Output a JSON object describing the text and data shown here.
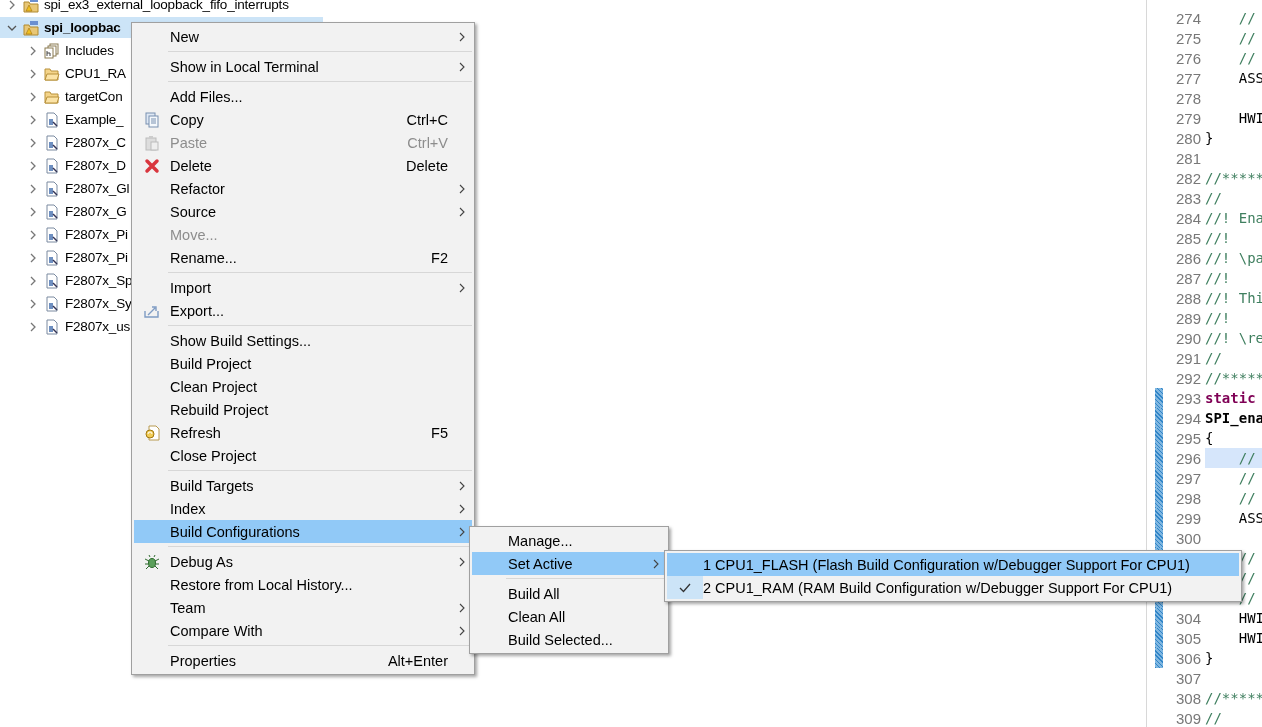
{
  "tree": [
    {
      "label": "spi_ex3_external_loopback_fifo_interrupts",
      "kind": "project",
      "expanded": false,
      "selected": false
    },
    {
      "label": "spi_loopbac",
      "kind": "project",
      "expanded": true,
      "selected": true,
      "children": [
        {
          "label": "Includes",
          "kind": "includes",
          "expanded": false,
          "selected": false
        },
        {
          "label": "CPU1_RA",
          "kind": "folder",
          "expanded": false,
          "selected": false
        },
        {
          "label": "targetCon",
          "kind": "folder",
          "expanded": false,
          "selected": false
        },
        {
          "label": "Example_",
          "kind": "file",
          "expanded": false,
          "selected": false
        },
        {
          "label": "F2807x_C",
          "kind": "file",
          "expanded": false,
          "selected": false
        },
        {
          "label": "F2807x_D",
          "kind": "file",
          "expanded": false,
          "selected": false
        },
        {
          "label": "F2807x_Gl",
          "kind": "file",
          "expanded": false,
          "selected": false
        },
        {
          "label": "F2807x_G",
          "kind": "file",
          "expanded": false,
          "selected": false
        },
        {
          "label": "F2807x_Pi",
          "kind": "file",
          "expanded": false,
          "selected": false
        },
        {
          "label": "F2807x_Pi",
          "kind": "file",
          "expanded": false,
          "selected": false
        },
        {
          "label": "F2807x_Sp",
          "kind": "file",
          "expanded": false,
          "selected": false
        },
        {
          "label": "F2807x_Sy",
          "kind": "file",
          "expanded": false,
          "selected": false
        },
        {
          "label": "F2807x_us",
          "kind": "file",
          "expanded": false,
          "selected": false
        }
      ]
    }
  ],
  "editor": {
    "lines": [
      {
        "number": "274",
        "code": "    //",
        "kind": "comment",
        "changed": false,
        "current": false
      },
      {
        "number": "275",
        "code": "    //",
        "kind": "comment",
        "changed": false,
        "current": false
      },
      {
        "number": "276",
        "code": "    //",
        "kind": "comment",
        "changed": false,
        "current": false
      },
      {
        "number": "277",
        "code": "    ASS",
        "kind": "plain",
        "changed": false,
        "current": false
      },
      {
        "number": "278",
        "changed": false
      },
      {
        "number": "279",
        "code": "    HWI",
        "kind": "plain",
        "changed": false,
        "current": false
      },
      {
        "number": "280",
        "code": "}",
        "kind": "plain",
        "changed": false,
        "current": false
      },
      {
        "number": "281",
        "changed": false
      },
      {
        "number": "282",
        "code": "//*****",
        "kind": "comment",
        "changed": false,
        "current": false
      },
      {
        "number": "283",
        "code": "//",
        "kind": "comment",
        "changed": false,
        "current": false
      },
      {
        "number": "284",
        "code": "//! Ena",
        "kind": "comment",
        "changed": false,
        "current": false
      },
      {
        "number": "285",
        "code": "//!",
        "kind": "comment",
        "changed": false,
        "current": false
      },
      {
        "number": "286",
        "code": "//! \\pa",
        "kind": "comment",
        "changed": false,
        "current": false
      },
      {
        "number": "287",
        "code": "//!",
        "kind": "comment",
        "changed": false,
        "current": false
      },
      {
        "number": "288",
        "code": "//! Thi",
        "kind": "comment",
        "changed": false,
        "current": false
      },
      {
        "number": "289",
        "code": "//!",
        "kind": "comment",
        "changed": false,
        "current": false
      },
      {
        "number": "290",
        "code": "//! \\re",
        "kind": "comment",
        "changed": false,
        "current": false
      },
      {
        "number": "291",
        "code": "//",
        "kind": "comment",
        "changed": false,
        "current": false
      },
      {
        "number": "292",
        "code": "//*****",
        "kind": "comment",
        "changed": false,
        "current": false
      },
      {
        "number": "293",
        "code": "static",
        "kind": "keyword",
        "changed": true,
        "current": false
      },
      {
        "number": "294",
        "code": "SPI_ena",
        "kind": "function",
        "changed": true,
        "current": false
      },
      {
        "number": "295",
        "code": "{",
        "kind": "plain",
        "changed": true,
        "current": false
      },
      {
        "number": "296",
        "code": "    //",
        "kind": "comment",
        "changed": true,
        "current": true
      },
      {
        "number": "297",
        "code": "    //",
        "kind": "comment",
        "changed": true,
        "current": false
      },
      {
        "number": "298",
        "code": "    //",
        "kind": "comment",
        "changed": true,
        "current": false
      },
      {
        "number": "299",
        "code": "    ASS",
        "kind": "plain",
        "changed": true,
        "current": false
      },
      {
        "number": "300",
        "changed": true
      },
      {
        "code": "    //",
        "kind": "comment",
        "changed": true,
        "current": false
      },
      {
        "code": "    //",
        "kind": "comment",
        "current": false
      },
      {
        "code": "    //",
        "kind": "comment",
        "changed": true,
        "current": false
      },
      {
        "number": "304",
        "code": "    HWI",
        "kind": "plain",
        "changed": true,
        "current": false
      },
      {
        "number": "305",
        "code": "    HWI",
        "kind": "plain",
        "changed": true,
        "current": false
      },
      {
        "number": "306",
        "code": "}",
        "kind": "plain",
        "changed": true,
        "current": false
      },
      {
        "number": "307",
        "changed": false
      },
      {
        "number": "308",
        "code": "//*****",
        "kind": "comment",
        "changed": false,
        "current": false
      },
      {
        "number": "309",
        "code": "//",
        "kind": "comment",
        "changed": false,
        "current": false
      }
    ]
  },
  "context_menu": {
    "items": [
      {
        "kind": "item",
        "label": "New",
        "submenu": true,
        "disabled": false,
        "selected": false
      },
      {
        "kind": "separator"
      },
      {
        "kind": "item",
        "label": "Show in Local Terminal",
        "submenu": true,
        "disabled": false,
        "selected": false
      },
      {
        "kind": "separator"
      },
      {
        "kind": "item",
        "label": "Add Files...",
        "submenu": false,
        "disabled": false,
        "selected": false
      },
      {
        "kind": "copy",
        "label": "Copy",
        "shortcut": "Ctrl+C",
        "submenu": false,
        "disabled": false,
        "selected": false
      },
      {
        "kind": "paste",
        "label": "Paste",
        "shortcut": "Ctrl+V",
        "submenu": false,
        "disabled": true,
        "selected": false
      },
      {
        "kind": "delete",
        "label": "Delete",
        "shortcut": "Delete",
        "submenu": false,
        "disabled": false,
        "selected": false
      },
      {
        "kind": "item",
        "label": "Refactor",
        "submenu": true,
        "disabled": false,
        "selected": false
      },
      {
        "kind": "item",
        "label": "Source",
        "submenu": true,
        "disabled": false,
        "selected": false
      },
      {
        "kind": "item",
        "label": "Move...",
        "submenu": false,
        "disabled": true,
        "selected": false
      },
      {
        "kind": "item",
        "label": "Rename...",
        "shortcut": "F2",
        "submenu": false,
        "disabled": false,
        "selected": false
      },
      {
        "kind": "separator"
      },
      {
        "kind": "item",
        "label": "Import",
        "submenu": true,
        "disabled": false,
        "selected": false
      },
      {
        "kind": "export",
        "label": "Export...",
        "submenu": false,
        "disabled": false,
        "selected": false
      },
      {
        "kind": "separator"
      },
      {
        "kind": "item",
        "label": "Show Build Settings...",
        "submenu": false,
        "disabled": false,
        "selected": false
      },
      {
        "kind": "item",
        "label": "Build Project",
        "submenu": false,
        "disabled": false,
        "selected": false
      },
      {
        "kind": "item",
        "label": "Clean Project",
        "submenu": false,
        "disabled": false,
        "selected": false
      },
      {
        "kind": "item",
        "label": "Rebuild Project",
        "submenu": false,
        "disabled": false,
        "selected": false
      },
      {
        "kind": "refresh",
        "label": "Refresh",
        "shortcut": "F5",
        "submenu": false,
        "disabled": false,
        "selected": false
      },
      {
        "kind": "item",
        "label": "Close Project",
        "submenu": false,
        "disabled": false,
        "selected": false
      },
      {
        "kind": "separator"
      },
      {
        "kind": "item",
        "label": "Build Targets",
        "submenu": true,
        "disabled": false,
        "selected": false
      },
      {
        "kind": "item",
        "label": "Index",
        "submenu": true,
        "disabled": false,
        "selected": false
      },
      {
        "kind": "item",
        "label": "Build Configurations",
        "submenu": true,
        "disabled": false,
        "selected": true
      },
      {
        "kind": "separator"
      },
      {
        "kind": "debug",
        "label": "Debug As",
        "submenu": true,
        "disabled": false,
        "selected": false
      },
      {
        "kind": "item",
        "label": "Restore from Local History...",
        "submenu": false,
        "disabled": false,
        "selected": false
      },
      {
        "kind": "item",
        "label": "Team",
        "submenu": true,
        "disabled": false,
        "selected": false
      },
      {
        "kind": "item",
        "label": "Compare With",
        "submenu": true,
        "disabled": false,
        "selected": false
      },
      {
        "kind": "separator"
      },
      {
        "kind": "item",
        "label": "Properties",
        "shortcut": "Alt+Enter",
        "submenu": false,
        "disabled": false,
        "selected": false
      }
    ]
  },
  "build_configurations_menu": {
    "items": [
      {
        "kind": "item",
        "label": "Manage...",
        "submenu": false,
        "disabled": false,
        "selected": false
      },
      {
        "kind": "item",
        "label": "Set Active",
        "submenu": true,
        "disabled": false,
        "selected": true
      },
      {
        "kind": "separator"
      },
      {
        "kind": "item",
        "label": "Build All",
        "submenu": false,
        "disabled": false,
        "selected": false
      },
      {
        "kind": "item",
        "label": "Clean All",
        "submenu": false,
        "disabled": false,
        "selected": false
      },
      {
        "kind": "item",
        "label": "Build Selected...",
        "submenu": false,
        "disabled": false,
        "selected": false
      }
    ]
  },
  "set_active_menu": {
    "items": [
      {
        "kind": "item",
        "label": "1 CPU1_FLASH (Flash Build Configuration w/Debugger Support For CPU1)",
        "checked": false,
        "submenu": false,
        "disabled": false,
        "selected": true
      },
      {
        "kind": "item",
        "label": "2 CPU1_RAM (RAM Build Configuration w/Debugger Support For CPU1)",
        "checked": true,
        "submenu": false,
        "disabled": false,
        "selected": false
      }
    ]
  }
}
